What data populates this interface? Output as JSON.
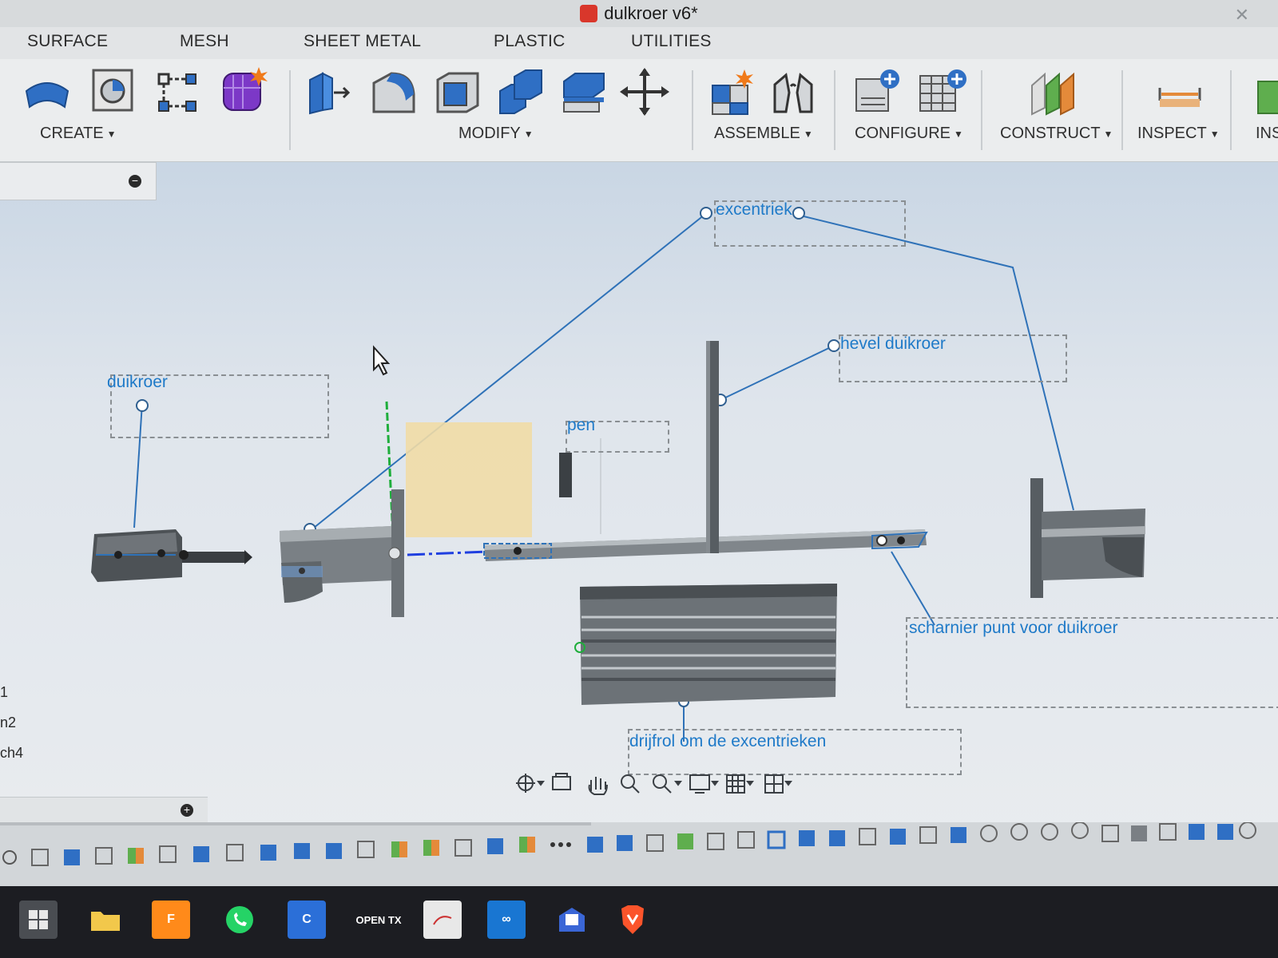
{
  "window": {
    "title": "dulkroer v6*"
  },
  "tabs": [
    "SURFACE",
    "MESH",
    "SHEET METAL",
    "PLASTIC",
    "UTILITIES"
  ],
  "toolbar": {
    "groups": {
      "create": "CREATE",
      "modify": "MODIFY",
      "assemble": "ASSEMBLE",
      "configure": "CONFIGURE",
      "construct": "CONSTRUCT",
      "inspect": "INSPECT",
      "insert_partial": "INS"
    }
  },
  "annotations": {
    "duikroer": "duikroer",
    "excentriek": "excentriek",
    "hevel": "hevel duikroer",
    "pen": "pen",
    "scharnier": "scharnier punt voor duikroer",
    "drijfrol": "drijfrol om de excentrieken"
  },
  "side_labels": [
    "1",
    "n2",
    "ch4"
  ],
  "taskbar": {
    "openTx": "OPEN TX"
  },
  "colors": {
    "annotation": "#1f7ac8",
    "leader": "#2f72b8",
    "axis_green": "#1fae3c",
    "yellow_plane": "#f1dca6"
  }
}
